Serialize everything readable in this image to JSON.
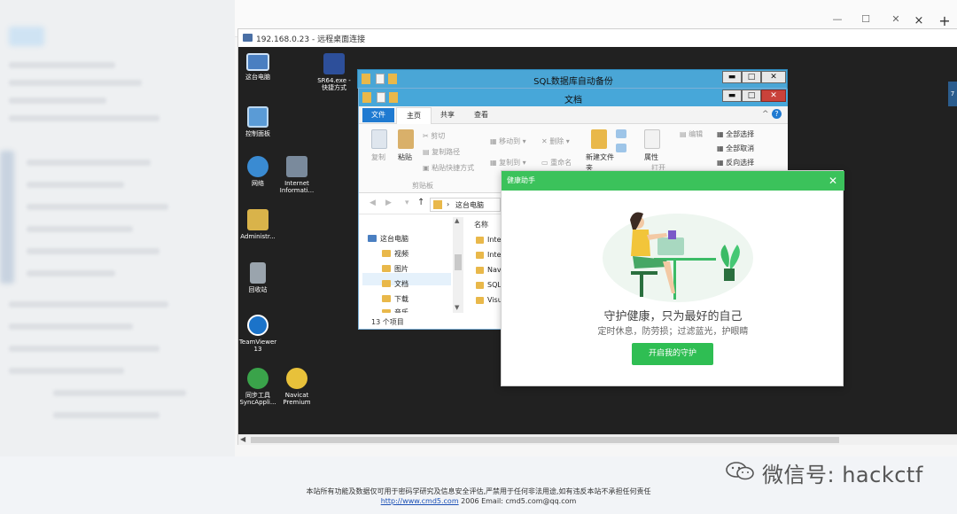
{
  "browser": {
    "close_tab": "×",
    "new_tab": "+",
    "minimize": "—",
    "maximize": "☐",
    "close": "✕"
  },
  "rdp": {
    "title": "192.168.0.23 - 远程桌面连接"
  },
  "desktop_icons": [
    {
      "label": "这台电脑",
      "icon": "computer-icon",
      "color": "#4a7fc1"
    },
    {
      "label": "SR64.exe - 快捷方式",
      "icon": "shortcut-exe-icon",
      "color": "#2d4f9a"
    },
    {
      "label": "控制面板",
      "icon": "control-panel-icon",
      "color": "#5a9bd6"
    },
    {
      "label": "网络",
      "icon": "network-icon",
      "color": "#3a8bd2"
    },
    {
      "label": "Internet Informati...",
      "icon": "iis-icon",
      "color": "#7a8a9c"
    },
    {
      "label": "Administr...",
      "icon": "user-folder-icon",
      "color": "#d9b34a"
    },
    {
      "label": "回收站",
      "icon": "recycle-bin-icon",
      "color": "#9aa4ad"
    },
    {
      "label": "TeamViewer 13",
      "icon": "teamviewer-icon",
      "color": "#1b73c9"
    },
    {
      "label": "同步工具 SyncAppli...",
      "icon": "sync-app-icon",
      "color": "#3aa34a"
    },
    {
      "label": "Navicat Premium",
      "icon": "navicat-icon",
      "color": "#e8c13a"
    }
  ],
  "sql_window": {
    "title": "SQL数据库自动备份"
  },
  "explorer": {
    "title": "文档",
    "tabs": [
      "文件",
      "主页",
      "共享",
      "查看"
    ],
    "ribbon": {
      "copy": "复制",
      "paste": "粘贴",
      "cut": "剪切",
      "copy_path": "复制路径",
      "paste_shortcut": "粘贴快捷方式",
      "clipboard_group": "剪贴板",
      "move_to": "移动到",
      "delete": "删除",
      "copy_to": "复制到",
      "rename": "重命名",
      "new_folder": "新建文件夹",
      "properties": "属性",
      "open": "打开",
      "edit": "编辑",
      "select_all": "全部选择",
      "select_none": "全部取消",
      "invert_selection": "反向选择"
    },
    "address": "这台电脑",
    "column_name": "名称",
    "nav_items": [
      "这台电脑",
      "视频",
      "图片",
      "文档",
      "下载",
      "音乐"
    ],
    "files": [
      "Inte",
      "Inte",
      "Nav",
      "SQL",
      "Visu"
    ],
    "status": "13 个项目"
  },
  "popup": {
    "title": "健康助手",
    "close": "✕",
    "heading": "守护健康，只为最好的自己",
    "subheading": "定时休息，防劳损；过滤蓝光，护眼睛",
    "button": "开启我的守护"
  },
  "side_widget": "7",
  "footer": {
    "notice": "本站所有功能及数据仅可用于密码学研究及信息安全评估,严禁用于任何非法用途,如有违反本站不承担任何责任",
    "link": "http://www.cmd5.com",
    "year": "2006",
    "email_label": "Email:",
    "email": "cmd5.com@qq.com"
  },
  "watermark": {
    "text": "微信号: hackctf"
  }
}
